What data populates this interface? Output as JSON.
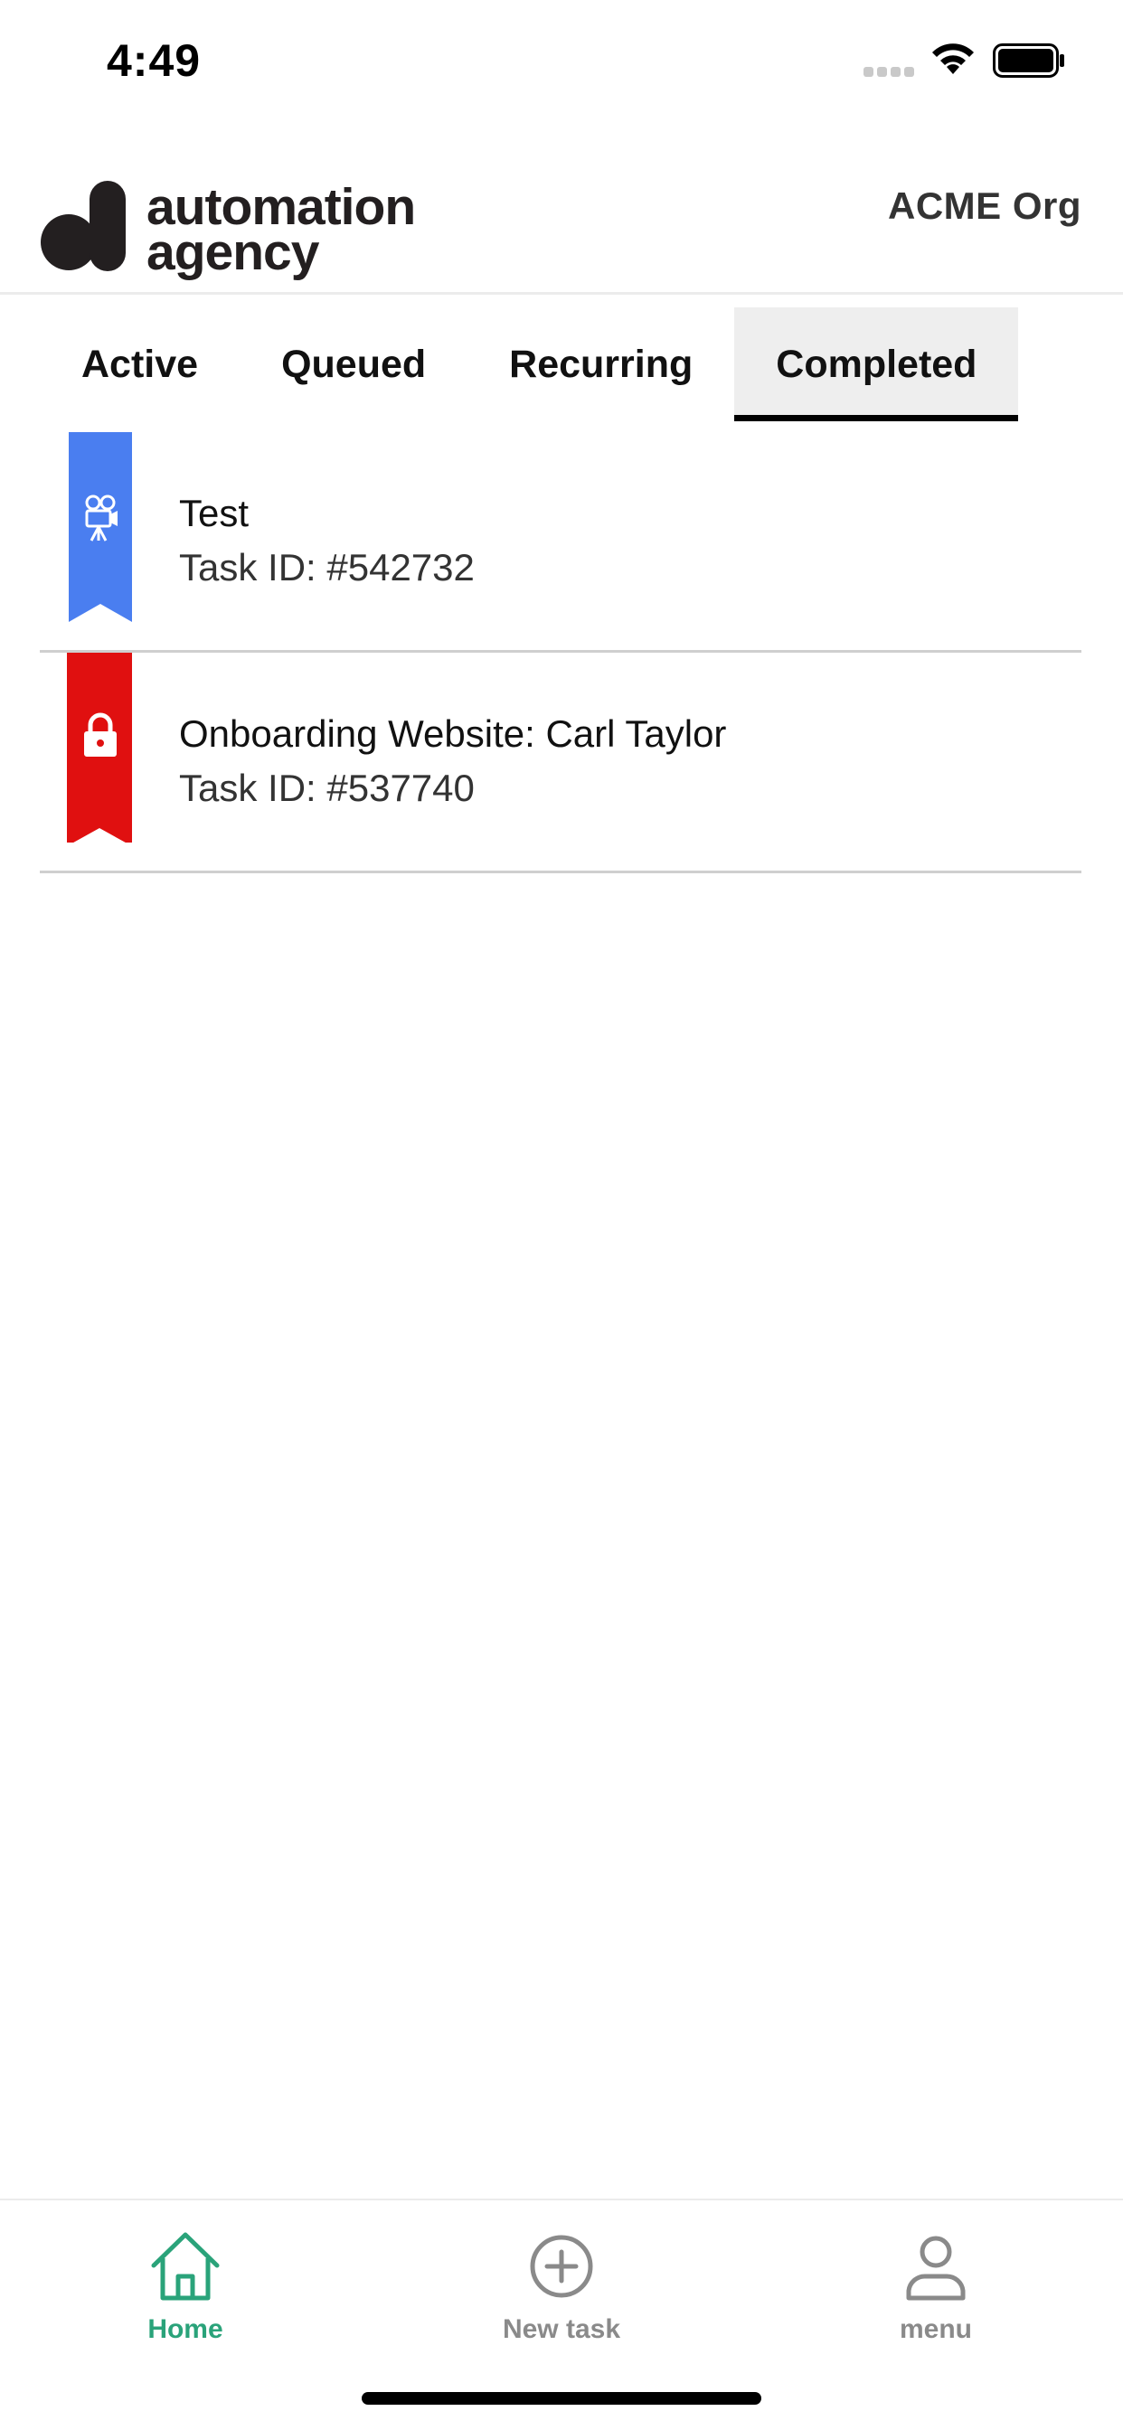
{
  "status_bar": {
    "time": "4:49"
  },
  "header": {
    "logo_line1": "automation",
    "logo_line2": "agency",
    "org_name": "ACME Org"
  },
  "tabs": [
    {
      "label": "Active"
    },
    {
      "label": "Queued"
    },
    {
      "label": "Recurring"
    },
    {
      "label": "Completed",
      "selected": true
    }
  ],
  "tasks": [
    {
      "title": "Test",
      "task_id": "Task ID: #542732",
      "ribbon_color": "#4a7ef0",
      "icon": "video-camera-icon"
    },
    {
      "title": "Onboarding Website: Carl Taylor",
      "task_id": "Task ID: #537740",
      "ribbon_color": "#e01010",
      "icon": "lock-icon"
    }
  ],
  "bottom_nav": [
    {
      "label": "Home",
      "icon": "home-icon",
      "active": true
    },
    {
      "label": "New task",
      "icon": "plus-circle-icon"
    },
    {
      "label": "menu",
      "icon": "person-icon"
    }
  ],
  "colors": {
    "accent": "#2aa37a",
    "inactive": "#8a8a8a"
  }
}
